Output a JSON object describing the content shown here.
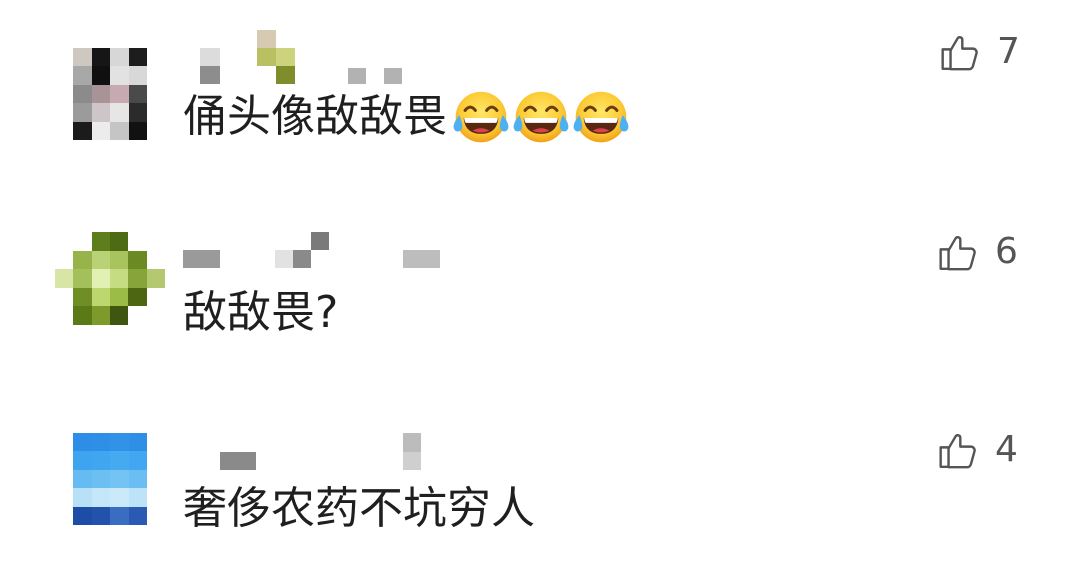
{
  "comments": [
    {
      "text": "俑头像敌敌畏",
      "emojis": [
        "tears-of-joy",
        "tears-of-joy",
        "tears-of-joy"
      ],
      "likes": "7"
    },
    {
      "text": "敌敌畏?",
      "emojis": [],
      "likes": "6"
    },
    {
      "text": "奢侈农药不坑穷人",
      "emojis": [],
      "likes": "4"
    }
  ],
  "icons": {
    "like": "thumbs-up",
    "emoji": "tears-of-joy"
  },
  "colors": {
    "text": "#1f1f1f",
    "like_count": "#555555",
    "background": "#ffffff"
  }
}
